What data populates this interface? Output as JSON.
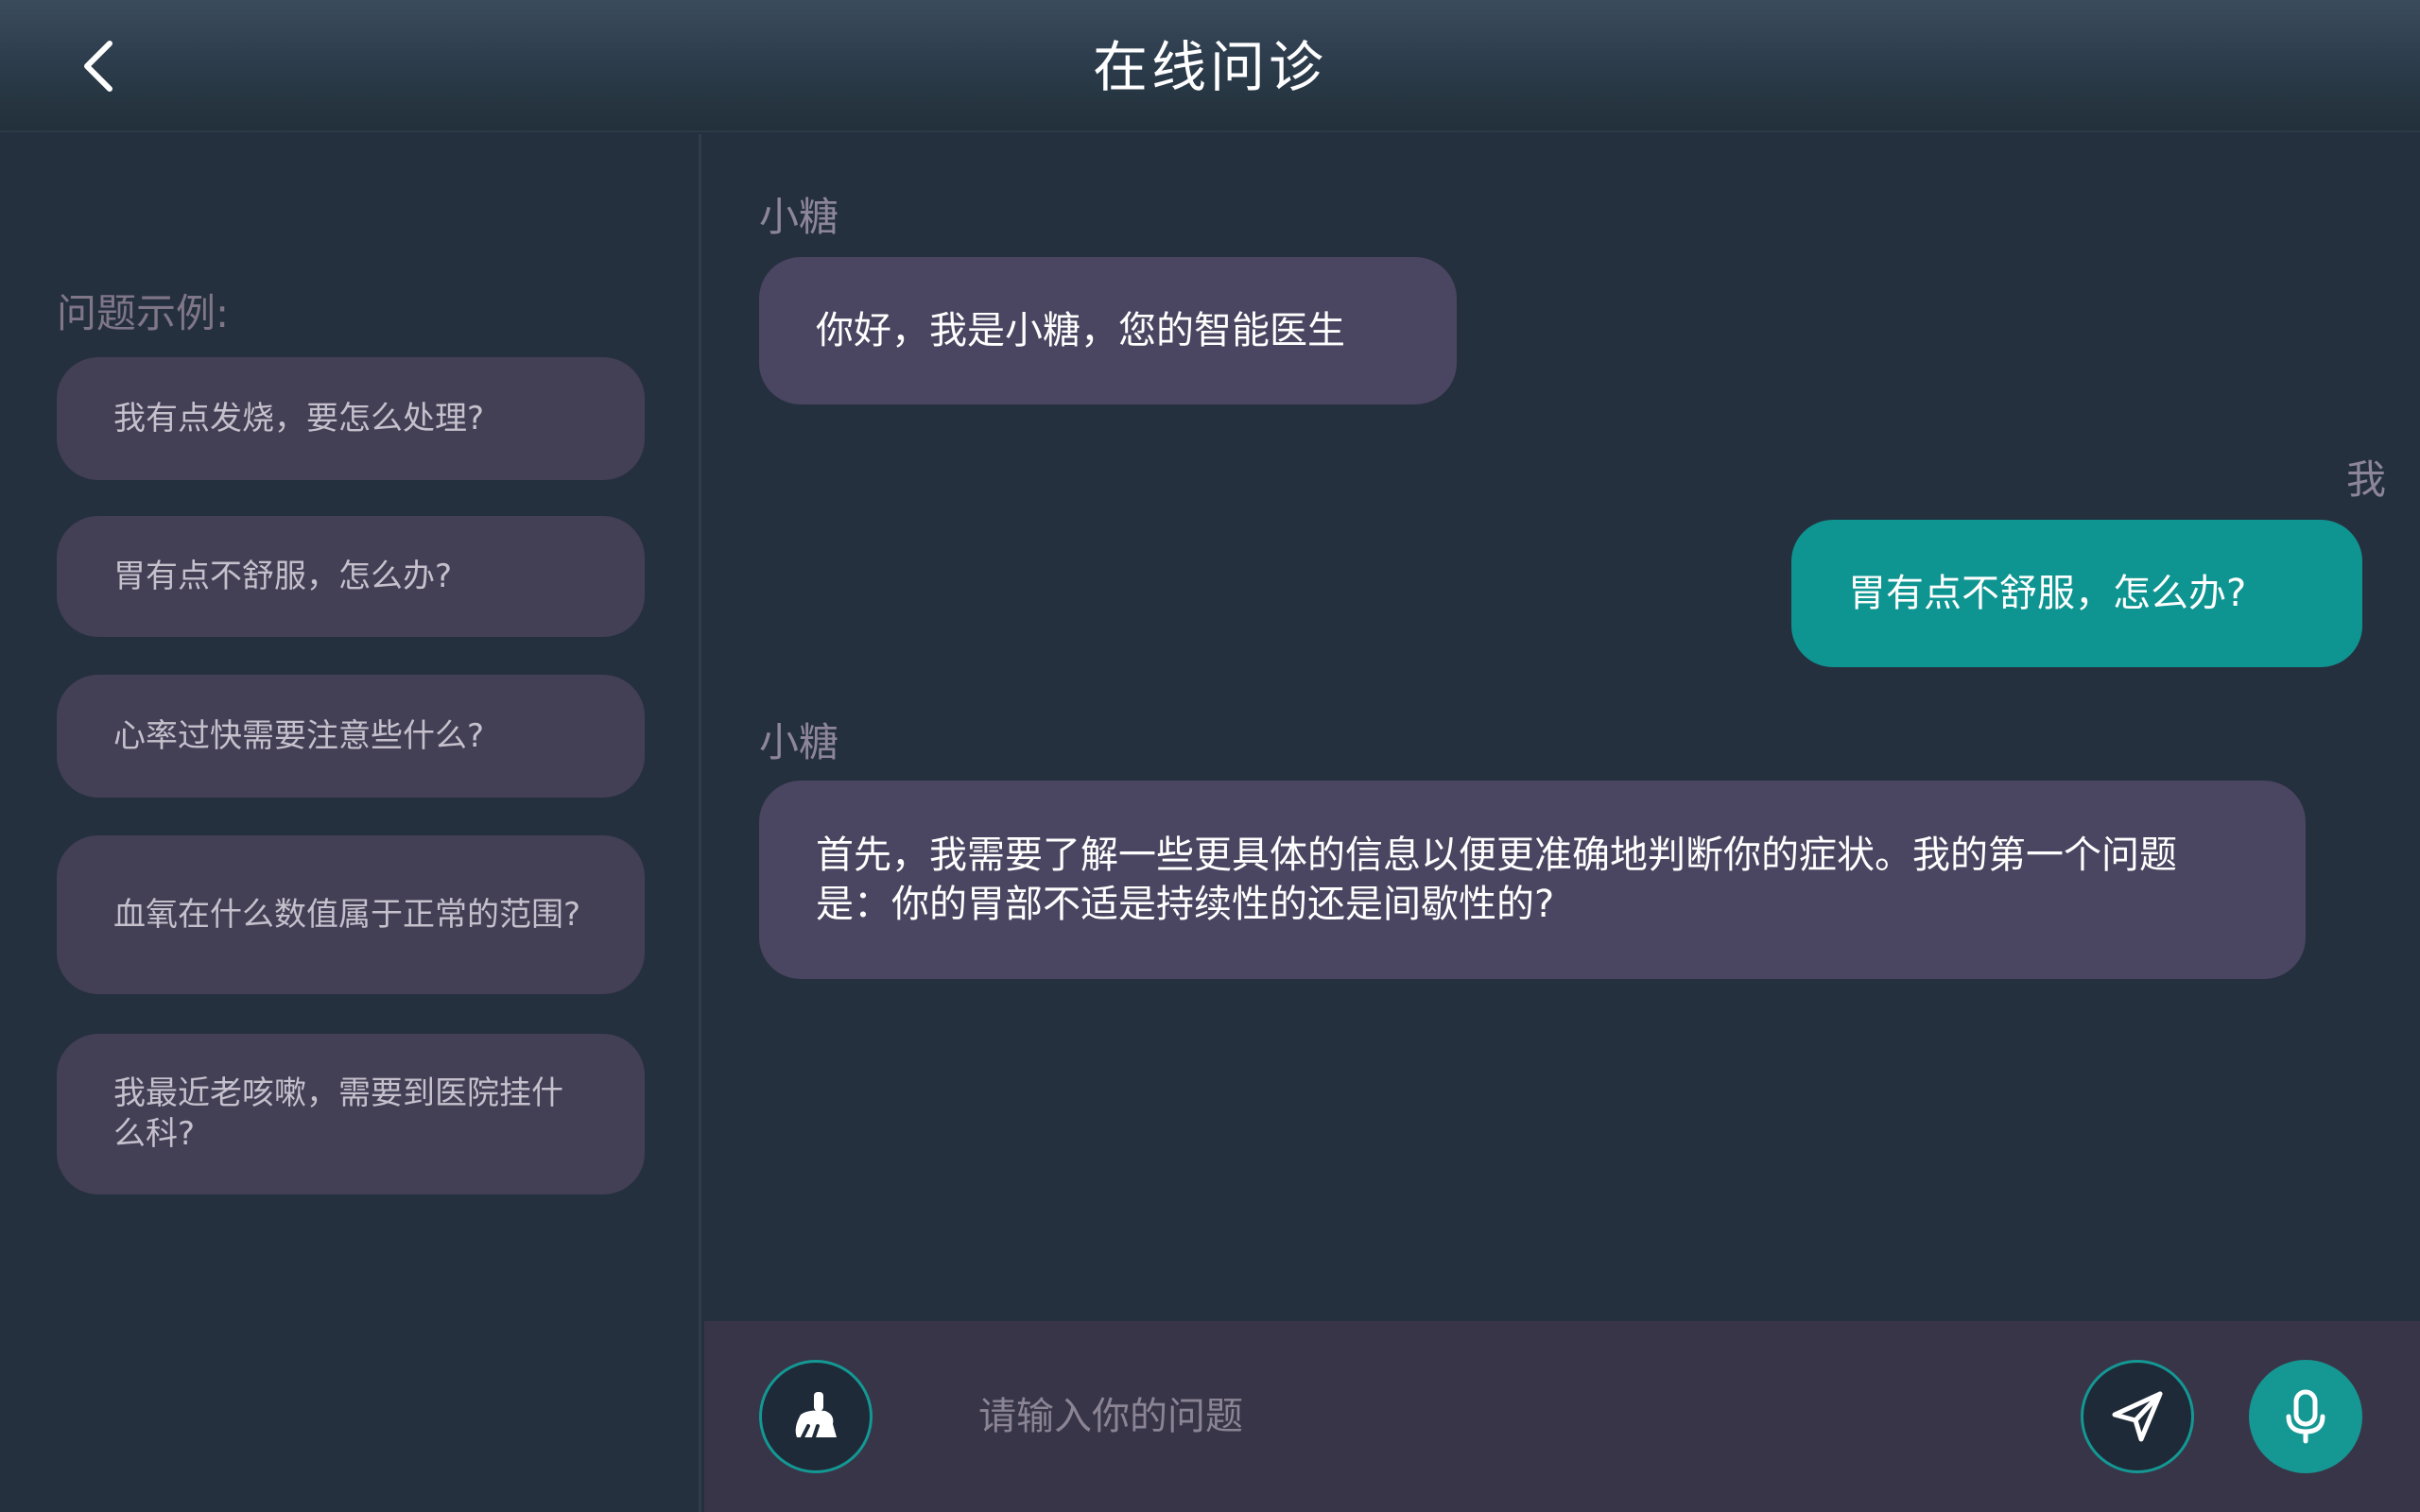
{
  "header": {
    "title": "在线问诊",
    "back_icon": "chevron-left-icon"
  },
  "sidebar": {
    "heading": "问题示例:",
    "examples": [
      "我有点发烧，要怎么处理?",
      "胃有点不舒服，怎么办?",
      "心率过快需要注意些什么?",
      "血氧在什么数值属于正常的范围?",
      "我最近老咳嗽，需要到医院挂什么科?"
    ]
  },
  "chat": {
    "messages": [
      {
        "sender": "小糖",
        "role": "bot",
        "text": "你好，我是小糖，您的智能医生"
      },
      {
        "sender": "我",
        "role": "user",
        "text": "胃有点不舒服，怎么办?"
      },
      {
        "sender": "小糖",
        "role": "bot",
        "text": "首先，我需要了解一些更具体的信息以便更准确地判断你的症状。我的第一个问题是：你的胃部不适是持续性的还是间歇性的?"
      }
    ]
  },
  "input_bar": {
    "placeholder": "请输入你的问题",
    "value": "",
    "clear_icon": "broom-icon",
    "send_icon": "paper-plane-icon",
    "mic_icon": "microphone-icon"
  },
  "colors": {
    "background": "#25303f",
    "accent": "#0e9591",
    "bot_bubble": "#4a4560",
    "example_card": "#433f55",
    "input_bar": "#393548"
  }
}
